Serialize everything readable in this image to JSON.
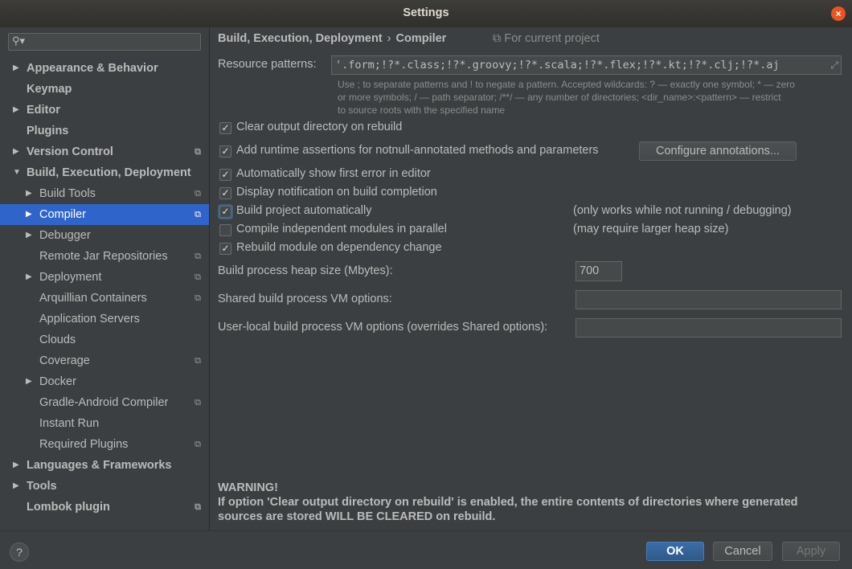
{
  "window": {
    "title": "Settings",
    "close_glyph": "×"
  },
  "sidebar": {
    "search_placeholder": "",
    "items": [
      {
        "label": "Appearance & Behavior",
        "bold": true,
        "arrow": "▶",
        "level": 0
      },
      {
        "label": "Keymap",
        "bold": true,
        "arrow": "",
        "level": 0
      },
      {
        "label": "Editor",
        "bold": true,
        "arrow": "▶",
        "level": 0
      },
      {
        "label": "Plugins",
        "bold": true,
        "arrow": "",
        "level": 0
      },
      {
        "label": "Version Control",
        "bold": true,
        "arrow": "▶",
        "level": 0,
        "project": true
      },
      {
        "label": "Build, Execution, Deployment",
        "bold": true,
        "arrow": "▼",
        "level": 0
      },
      {
        "label": "Build Tools",
        "arrow": "▶",
        "level": 1,
        "project": true
      },
      {
        "label": "Compiler",
        "arrow": "▶",
        "level": 1,
        "project": true,
        "selected": true
      },
      {
        "label": "Debugger",
        "arrow": "▶",
        "level": 1
      },
      {
        "label": "Remote Jar Repositories",
        "arrow": "",
        "level": 1,
        "project": true
      },
      {
        "label": "Deployment",
        "arrow": "▶",
        "level": 1,
        "project": true
      },
      {
        "label": "Arquillian Containers",
        "arrow": "",
        "level": 1,
        "project": true
      },
      {
        "label": "Application Servers",
        "arrow": "",
        "level": 1
      },
      {
        "label": "Clouds",
        "arrow": "",
        "level": 1
      },
      {
        "label": "Coverage",
        "arrow": "",
        "level": 1,
        "project": true
      },
      {
        "label": "Docker",
        "arrow": "▶",
        "level": 1
      },
      {
        "label": "Gradle-Android Compiler",
        "arrow": "",
        "level": 1,
        "project": true
      },
      {
        "label": "Instant Run",
        "arrow": "",
        "level": 1
      },
      {
        "label": "Required Plugins",
        "arrow": "",
        "level": 1,
        "project": true
      },
      {
        "label": "Languages & Frameworks",
        "bold": true,
        "arrow": "▶",
        "level": 0
      },
      {
        "label": "Tools",
        "bold": true,
        "arrow": "▶",
        "level": 0
      },
      {
        "label": "Lombok plugin",
        "bold": true,
        "arrow": "",
        "level": 0,
        "project": true
      }
    ],
    "project_glyph": "⧉"
  },
  "breadcrumb": {
    "parent": "Build, Execution, Deployment",
    "separator": "›",
    "current": "Compiler",
    "scope": "For current project",
    "scope_glyph": "⧉"
  },
  "resource": {
    "label": "Resource patterns:",
    "value": "'.form;!?*.class;!?*.groovy;!?*.scala;!?*.flex;!?*.kt;!?*.clj;!?*.aj",
    "hint_line1": "Use ; to separate patterns and ! to negate a pattern. Accepted wildcards: ? — exactly one symbol; * — zero",
    "hint_line2": "or more symbols; / — path separator; /**/ — any number of directories; <dir_name>:<pattern> — restrict",
    "hint_line3": "to source roots with the specified name"
  },
  "options": [
    {
      "label": "Clear output directory on rebuild",
      "checked": true,
      "note": ""
    },
    {
      "label": "Add runtime assertions for notnull-annotated methods and parameters",
      "checked": true,
      "note": ""
    },
    {
      "label": "Automatically show first error in editor",
      "checked": true,
      "note": ""
    },
    {
      "label": "Display notification on build completion",
      "checked": true,
      "note": ""
    },
    {
      "label": "Build project automatically",
      "checked": true,
      "note": "(only works while not running / debugging)"
    },
    {
      "label": "Compile independent modules in parallel",
      "checked": false,
      "note": "(may require larger heap size)"
    },
    {
      "label": "Rebuild module on dependency change",
      "checked": true,
      "note": ""
    }
  ],
  "check_glyph": "✓",
  "configure_button": "Configure annotations...",
  "heap": {
    "label": "Build process heap size (Mbytes):",
    "value": "700"
  },
  "shared_vm": {
    "label": "Shared build process VM options:",
    "value": ""
  },
  "user_vm": {
    "label": "User-local build process VM options (overrides Shared options):",
    "value": ""
  },
  "warning": {
    "title": "WARNING!",
    "line1": "If option 'Clear output directory on rebuild' is enabled, the entire contents of directories where generated",
    "line2": "sources are stored WILL BE CLEARED on rebuild."
  },
  "footer": {
    "help": "?",
    "ok": "OK",
    "cancel": "Cancel",
    "apply": "Apply"
  }
}
